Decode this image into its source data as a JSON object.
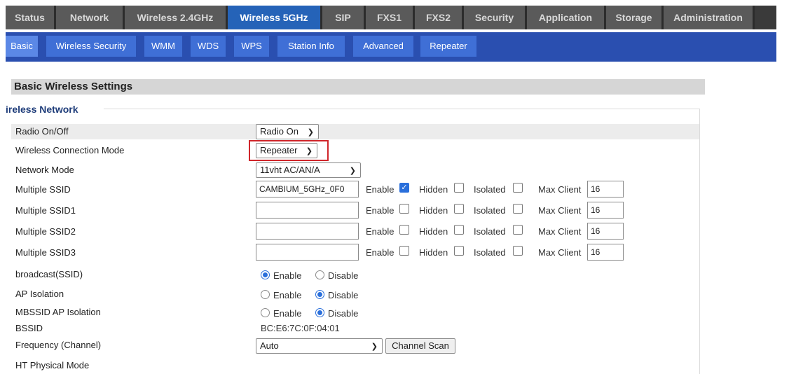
{
  "top_tabs": [
    "Status",
    "Network",
    "Wireless 2.4GHz",
    "Wireless 5GHz",
    "SIP",
    "FXS1",
    "FXS2",
    "Security",
    "Application",
    "Storage",
    "Administration"
  ],
  "active_top_tab": "Wireless 5GHz",
  "sub_tabs": [
    "Basic",
    "Wireless Security",
    "WMM",
    "WDS",
    "WPS",
    "Station Info",
    "Advanced",
    "Repeater"
  ],
  "active_sub_tab": "Basic",
  "section_title": "Basic Wireless Settings",
  "fieldset_legend": "ireless Network",
  "rows": {
    "radio_onoff": {
      "label": "Radio On/Off",
      "value": "Radio On"
    },
    "connection_mode": {
      "label": "Wireless Connection Mode",
      "value": "Repeater"
    },
    "network_mode": {
      "label": "Network Mode",
      "value": "11vht AC/AN/A"
    },
    "ssid": [
      {
        "label": "Multiple SSID",
        "value": "CAMBIUM_5GHz_0F0",
        "enable": true,
        "hidden": false,
        "isolated": false,
        "max_client": "16"
      },
      {
        "label": "Multiple SSID1",
        "value": "",
        "enable": false,
        "hidden": false,
        "isolated": false,
        "max_client": "16"
      },
      {
        "label": "Multiple SSID2",
        "value": "",
        "enable": false,
        "hidden": false,
        "isolated": false,
        "max_client": "16"
      },
      {
        "label": "Multiple SSID3",
        "value": "",
        "enable": false,
        "hidden": false,
        "isolated": false,
        "max_client": "16"
      }
    ],
    "ssid_labels": {
      "enable": "Enable",
      "hidden": "Hidden",
      "isolated": "Isolated",
      "max_client": "Max Client"
    },
    "broadcast": {
      "label": "broadcast(SSID)",
      "selected": "Enable"
    },
    "ap_isolation": {
      "label": "AP Isolation",
      "selected": "Disable"
    },
    "mbssid_isolation": {
      "label": "MBSSID AP Isolation",
      "selected": "Disable"
    },
    "radio_options": {
      "enable": "Enable",
      "disable": "Disable"
    },
    "bssid": {
      "label": "BSSID",
      "value": "BC:E6:7C:0F:04:01"
    },
    "frequency": {
      "label": "Frequency (Channel)",
      "value": "Auto",
      "scan_button": "Channel Scan"
    },
    "ht_mode": {
      "label": "HT Physical Mode"
    }
  },
  "colors": {
    "active_tab": "#2563b8",
    "subnav": "#2a4fb0",
    "highlight": "#d0262b",
    "accent": "#2a6fdb"
  },
  "icons": {
    "dropdown": "chevron-down-icon",
    "check": "checkmark-icon"
  }
}
